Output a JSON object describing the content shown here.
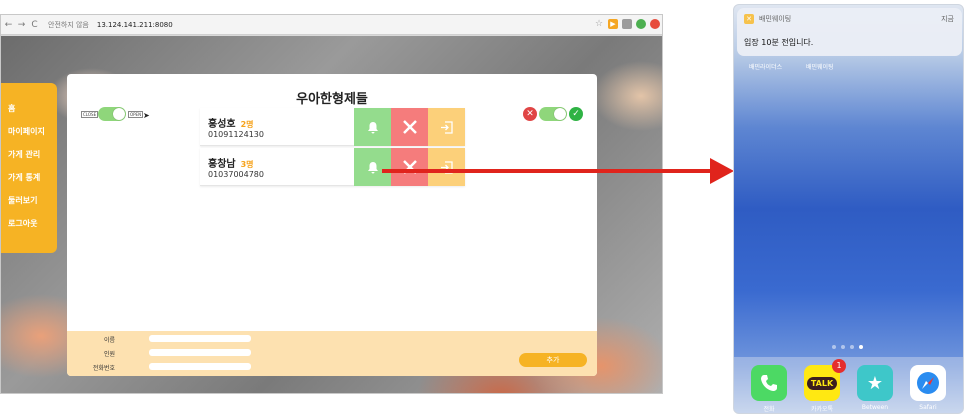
{
  "browser": {
    "secure_label": "안전하지 않음",
    "url": "13.124.141.211:8080",
    "back": "←",
    "forward": "→",
    "reload": "C"
  },
  "menu": {
    "items": [
      {
        "label": "홈"
      },
      {
        "label": "마이페이지"
      },
      {
        "label": "가게 관리"
      },
      {
        "label": "가게 통계"
      },
      {
        "label": "둘러보기"
      },
      {
        "label": "로그아웃"
      }
    ]
  },
  "card": {
    "title": "우아한형제들",
    "close_tag": "CLOSE",
    "open_tag": "OPEN"
  },
  "waiting": [
    {
      "name": "홍성호",
      "count": "2명",
      "phone": "01091124130"
    },
    {
      "name": "홍창남",
      "count": "3명",
      "phone": "01037004780"
    }
  ],
  "form": {
    "name_label": "이름",
    "people_label": "인원",
    "phone_label": "전화번호",
    "add_button": "추가"
  },
  "phone": {
    "notification": {
      "app": "배민웨이팅",
      "time": "지금",
      "message": "입장 10분 전입니다."
    },
    "home_apps": [
      "배민라이더스",
      "배민웨이팅"
    ],
    "dock": [
      {
        "label": "전화",
        "color": "#4cd964"
      },
      {
        "label": "카카오톡",
        "color": "#ffe812",
        "badge": "1",
        "glyph": "TALK"
      },
      {
        "label": "Between",
        "color": "#3ec7c9"
      },
      {
        "label": "Safari",
        "color": "#ffffff"
      }
    ]
  },
  "colors": {
    "accent": "#f6b324",
    "bell": "#94dc8d",
    "cancel": "#f57c7c",
    "enter": "#fcd07a",
    "arrow": "#e0241c"
  }
}
